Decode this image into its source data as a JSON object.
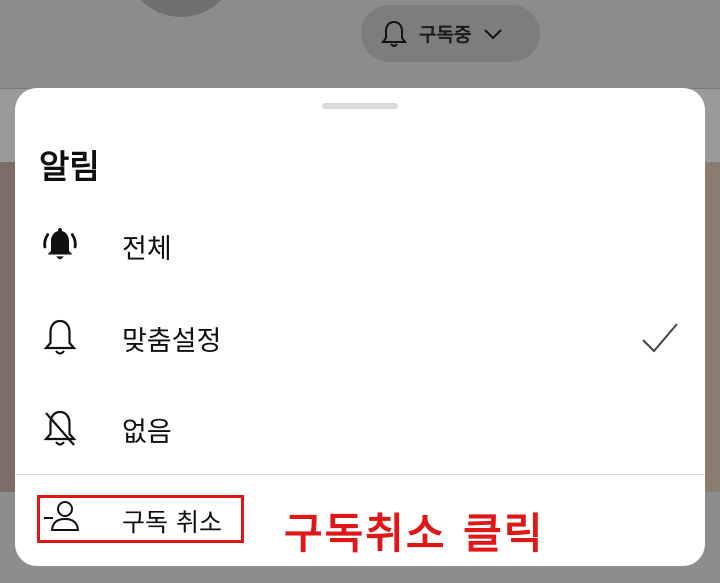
{
  "background": {
    "subscribe_button_label": "구독중"
  },
  "sheet": {
    "title": "알림",
    "options": [
      {
        "label": "전체",
        "icon": "bell-ringing-filled-icon",
        "selected": false
      },
      {
        "label": "맞춤설정",
        "icon": "bell-outline-icon",
        "selected": true
      },
      {
        "label": "없음",
        "icon": "bell-off-icon",
        "selected": false
      }
    ],
    "unsubscribe": {
      "label": "구독 취소",
      "icon": "person-remove-icon"
    }
  },
  "annotation": {
    "text": "구독취소 클릭",
    "color": "#e01717"
  }
}
